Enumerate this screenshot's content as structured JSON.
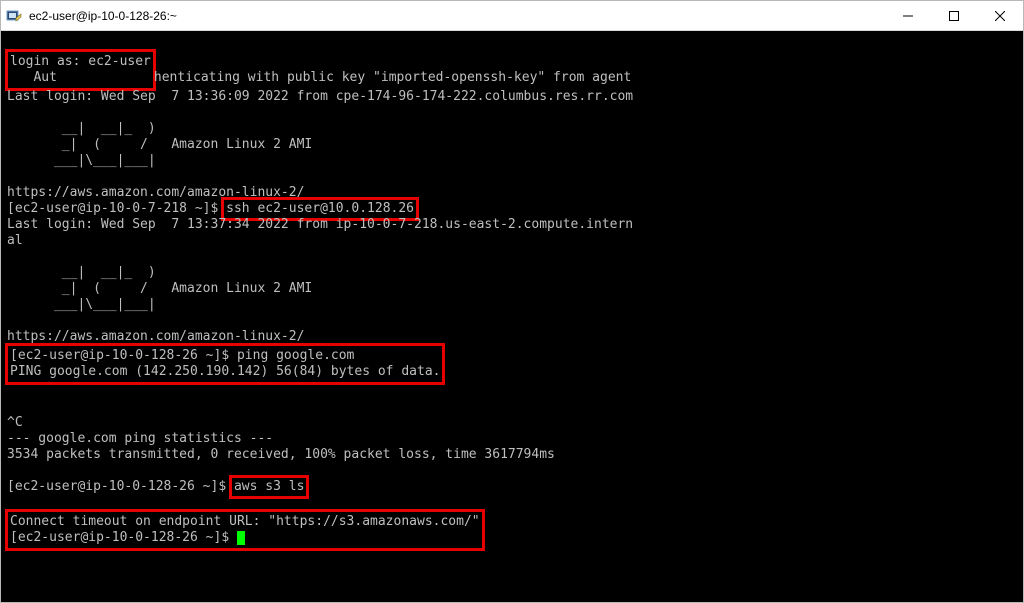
{
  "window": {
    "title": "ec2-user@ip-10-0-128-26:~"
  },
  "term": {
    "login_as": "login as: ec2-user",
    "auth_line_a": "   Aut",
    "auth_line_b": "henticating with public key \"imported-openssh-key\" from agent",
    "last_login1": "Last login: Wed Sep  7 13:36:09 2022 from cpe-174-96-174-222.columbus.res.rr.com",
    "ascii1_l1": "       __|  __|_  )",
    "ascii1_l2": "       _|  (     /   Amazon Linux 2 AMI",
    "ascii1_l3": "      ___|\\___|___|",
    "url1": "https://aws.amazon.com/amazon-linux-2/",
    "prompt1a": "[ec2-user@ip-10-0-7-218 ~]$ ",
    "ssh_cmd": "ssh ec2-user@10.0.128.26",
    "last_login2": "Last login: Wed Sep  7 13:37:34 2022 from ip-10-0-7-218.us-east-2.compute.intern",
    "al": "al",
    "ascii2_l1": "       __|  __|_  )",
    "ascii2_l2": "       _|  (     /   Amazon Linux 2 AMI",
    "ascii2_l3": "      ___|\\___|___|",
    "url2": "https://aws.amazon.com/amazon-linux-2/",
    "prompt2": "[ec2-user@ip-10-0-128-26 ~]$ ping google.com",
    "ping_header": "PING google.com (142.250.190.142) 56(84) bytes of data.",
    "ctrlc": "^C",
    "stats_hdr": "--- google.com ping statistics ---",
    "stats_line": "3534 packets transmitted, 0 received, 100% packet loss, time 3617794ms",
    "prompt3a": "[ec2-user@ip-10-0-128-26 ~]$ ",
    "aws_cmd": "aws s3 ls",
    "timeout": "Connect timeout on endpoint URL: \"https://s3.amazonaws.com/\"",
    "prompt4": "[ec2-user@ip-10-0-128-26 ~]$ "
  }
}
